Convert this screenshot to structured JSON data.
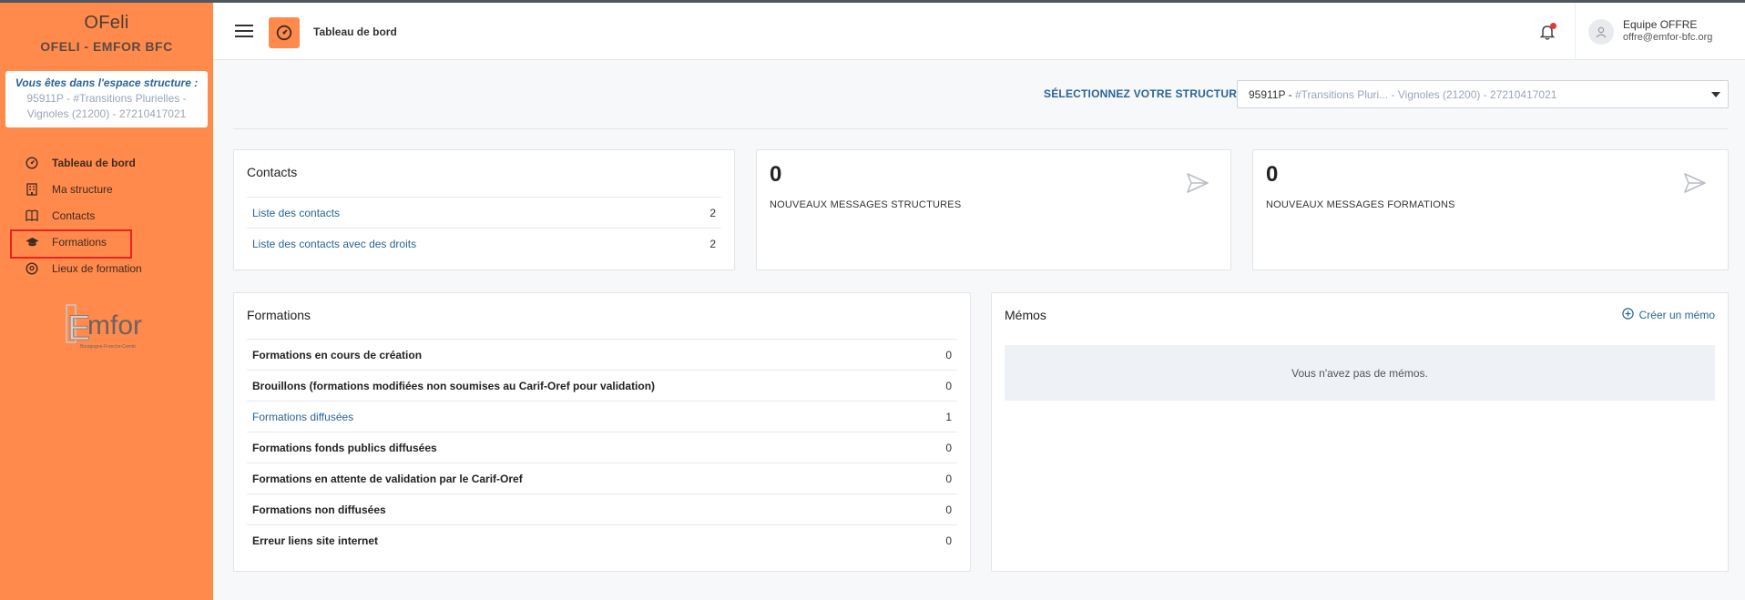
{
  "app": {
    "name": "OFeli",
    "org": "OFELI - EMFOR BFC"
  },
  "space": {
    "intro": "Vous êtes dans l'espace structure :",
    "detail": "95911P - #Transitions Plurielles - Vignoles (21200) - 27210417021"
  },
  "sidebar": {
    "items": [
      {
        "label": "Tableau de bord",
        "icon": "dashboard-icon"
      },
      {
        "label": "Ma structure",
        "icon": "building-icon"
      },
      {
        "label": "Contacts",
        "icon": "book-icon"
      },
      {
        "label": "Formations",
        "icon": "graduation-cap-icon"
      },
      {
        "label": "Lieux de formation",
        "icon": "map-pin-icon"
      }
    ],
    "logo_text": "Emfor",
    "logo_sub": "Bourgogne-Franche-Comté"
  },
  "header": {
    "title": "Tableau de bord",
    "user_name": "Equipe OFFRE",
    "user_email": "offre@emfor-bfc.org"
  },
  "structure_select": {
    "label": "SÉLECTIONNEZ VOTRE STRUCTURE",
    "code": "95911P - ",
    "value": "#Transitions Pluri... - Vignoles (21200) - 27210417021"
  },
  "contacts": {
    "title": "Contacts",
    "rows": [
      {
        "label": "Liste des contacts",
        "count": "2"
      },
      {
        "label": "Liste des contacts avec des droits",
        "count": "2"
      }
    ]
  },
  "messages_structures": {
    "count": "0",
    "label": "NOUVEAUX MESSAGES STRUCTURES"
  },
  "messages_formations": {
    "count": "0",
    "label": "NOUVEAUX MESSAGES FORMATIONS"
  },
  "formations": {
    "title": "Formations",
    "rows": [
      {
        "label": "Formations en cours de création",
        "count": "0"
      },
      {
        "label": "Brouillons (formations modifiées non soumises au Carif-Oref pour validation)",
        "count": "0"
      },
      {
        "label": "Formations diffusées",
        "count": "1"
      },
      {
        "label": "Formations fonds publics diffusées",
        "count": "0"
      },
      {
        "label": "Formations en attente de validation par le Carif-Oref",
        "count": "0"
      },
      {
        "label": "Formations non diffusées",
        "count": "0"
      },
      {
        "label": "Erreur liens site internet",
        "count": "0"
      }
    ]
  },
  "memos": {
    "title": "Mémos",
    "create_label": "Créer un mémo",
    "empty": "Vous n'avez pas de mémos."
  },
  "colors": {
    "sidebar": "#ff8a4c",
    "link": "#2a6496",
    "highlight": "#e8231d"
  }
}
